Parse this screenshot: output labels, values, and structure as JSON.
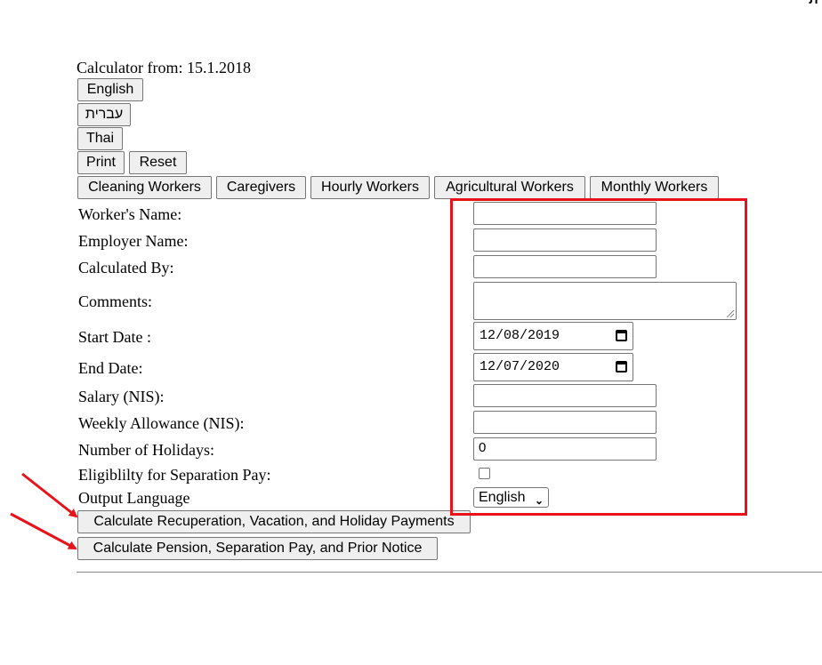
{
  "corner_text": "ית",
  "calculator_from": "Calculator from: 15.1.2018",
  "language_buttons": {
    "english": "English",
    "hebrew": "עברית",
    "thai": "Thai"
  },
  "actions": {
    "print": "Print",
    "reset": "Reset"
  },
  "worker_types": [
    "Cleaning Workers",
    "Caregivers",
    "Hourly Workers",
    "Agricultural Workers",
    "Monthly Workers"
  ],
  "form": {
    "workers_name_label": "Worker's Name:",
    "employer_name_label": "Employer Name:",
    "calculated_by_label": "Calculated By:",
    "comments_label": "Comments:",
    "start_date_label": "Start Date :",
    "start_date_value": "12/08/2019",
    "end_date_label": "End Date:",
    "end_date_value": "12/07/2020",
    "salary_label": "Salary (NIS):",
    "weekly_allowance_label": "Weekly Allowance (NIS):",
    "holidays_label": "Number of Holidays:",
    "holidays_value": "0",
    "separation_label": "Eligiblilty for Separation Pay:",
    "output_language_label": "Output Language",
    "output_language_value": "English"
  },
  "calc_buttons": {
    "recuperation": "Calculate Recuperation, Vacation, and Holiday Payments",
    "pension": "Calculate Pension, Separation Pay, and Prior Notice"
  },
  "annotation_color": "#e8121a"
}
